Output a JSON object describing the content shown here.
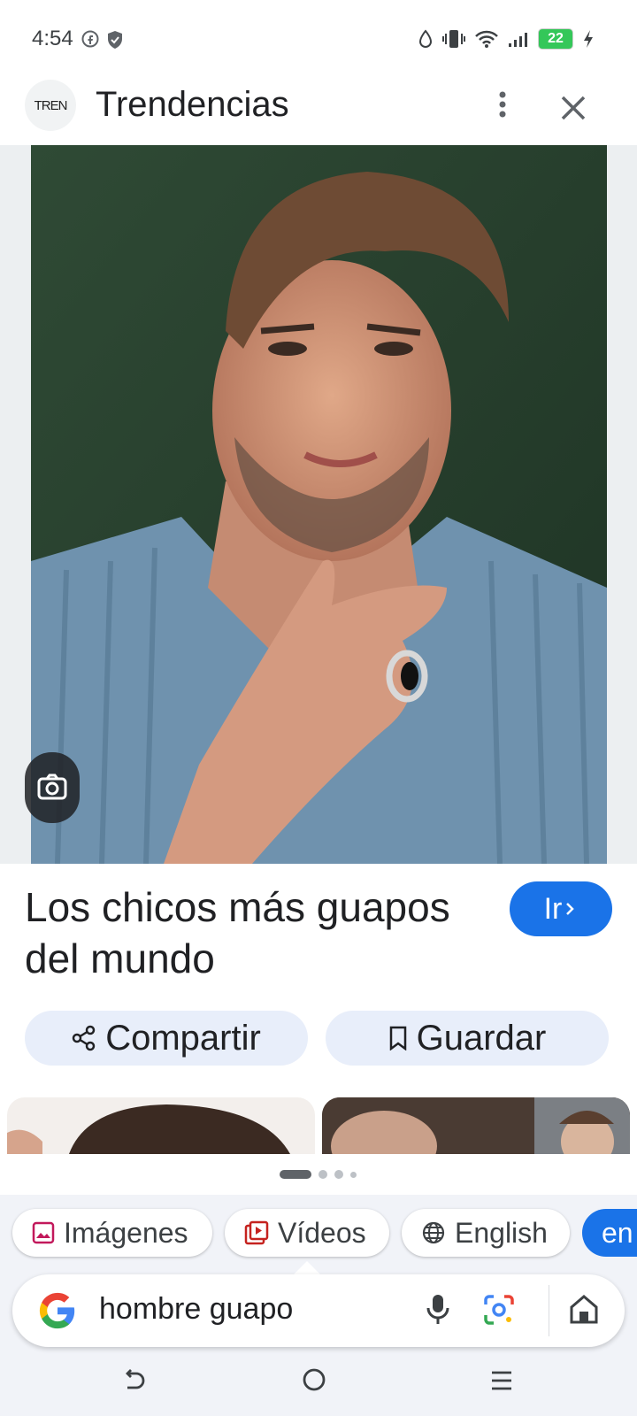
{
  "status": {
    "time": "4:54",
    "battery": "22"
  },
  "header": {
    "logo_text": "TREN",
    "title": "Trendencias"
  },
  "result": {
    "title": "Los chicos más guapos del mundo",
    "go_label": "Ir",
    "share_label": "Compartir",
    "save_label": "Guardar"
  },
  "chips": [
    {
      "label": "Imágenes",
      "icon": "image-icon"
    },
    {
      "label": "Vídeos",
      "icon": "video-icon"
    },
    {
      "label": "English",
      "icon": "globe-icon"
    },
    {
      "label": "en"
    }
  ],
  "search": {
    "query": "hombre guapo"
  },
  "colors": {
    "accent": "#1a73e8",
    "button_bg": "#e8eefa"
  }
}
